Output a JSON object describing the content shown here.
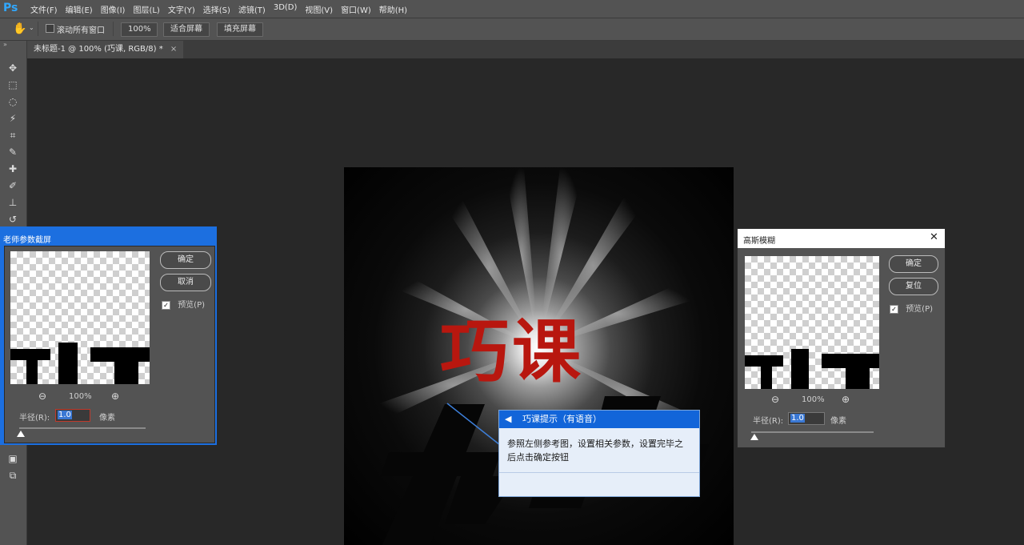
{
  "app": {
    "logo": "Ps"
  },
  "menu": [
    "文件(F)",
    "编辑(E)",
    "图像(I)",
    "图层(L)",
    "文字(Y)",
    "选择(S)",
    "滤镜(T)",
    "3D(D)",
    "视图(V)",
    "窗口(W)",
    "帮助(H)"
  ],
  "options_bar": {
    "scroll_all_label": "滚动所有窗口",
    "zoom_value": "100%",
    "fit_screen_label": "适合屏幕",
    "fill_screen_label": "填充屏幕"
  },
  "document_tab": {
    "title": "未标题-1 @ 100% (巧课, RGB/8) *",
    "close": "×"
  },
  "canvas": {
    "main_text": "巧课",
    "reflect_text": "巧课"
  },
  "teacher_dialog": {
    "title": "老师参数截屏",
    "ok_label": "确定",
    "cancel_label": "取消",
    "preview_label": "预览(P)",
    "preview_checked": true,
    "zoom": "100%",
    "radius_label": "半径(R):",
    "radius_value": "1.0",
    "unit": "像素",
    "slider_fraction": 0.0
  },
  "gaussian_dialog": {
    "title": "高斯模糊",
    "ok_label": "确定",
    "reset_label": "复位",
    "preview_label": "预览(P)",
    "preview_checked": true,
    "zoom": "100%",
    "radius_label": "半径(R):",
    "radius_value": "1.0",
    "unit": "像素",
    "slider_fraction": 0.0
  },
  "tip": {
    "header": "巧课提示（有语音）",
    "body": "参照左侧参考图，设置相关参数，设置完毕之后点击确定按钮"
  },
  "colors": {
    "brand_text": "#b8170f",
    "ps_blue": "#31a8ff",
    "dialog_title_blue": "#1c6fe0"
  }
}
